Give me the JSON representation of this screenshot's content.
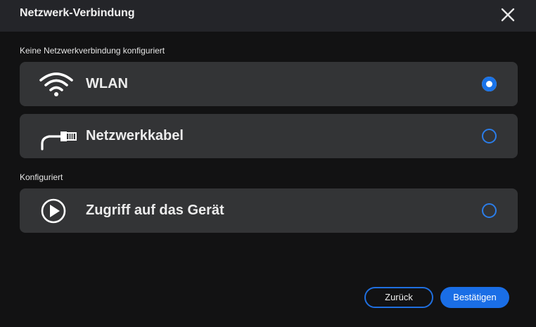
{
  "dialog": {
    "title": "Netzwerk-Verbindung",
    "close_icon": "close-icon"
  },
  "sections": {
    "unconfigured_label": "Keine Netzwerkverbindung konfiguriert",
    "configured_label": "Konfiguriert"
  },
  "options": [
    {
      "label": "WLAN",
      "icon": "wifi-icon",
      "selected": true
    },
    {
      "label": "Netzwerkkabel",
      "icon": "ethernet-cable-icon",
      "selected": false
    },
    {
      "label": "Zugriff auf das Gerät",
      "icon": "play-circle-icon",
      "selected": false
    }
  ],
  "buttons": {
    "back_label": "Zurück",
    "confirm_label": "Bestätigen"
  },
  "colors": {
    "accent": "#1a73e8",
    "panel": "#333436",
    "titlebar": "#242529",
    "background": "#121213"
  }
}
